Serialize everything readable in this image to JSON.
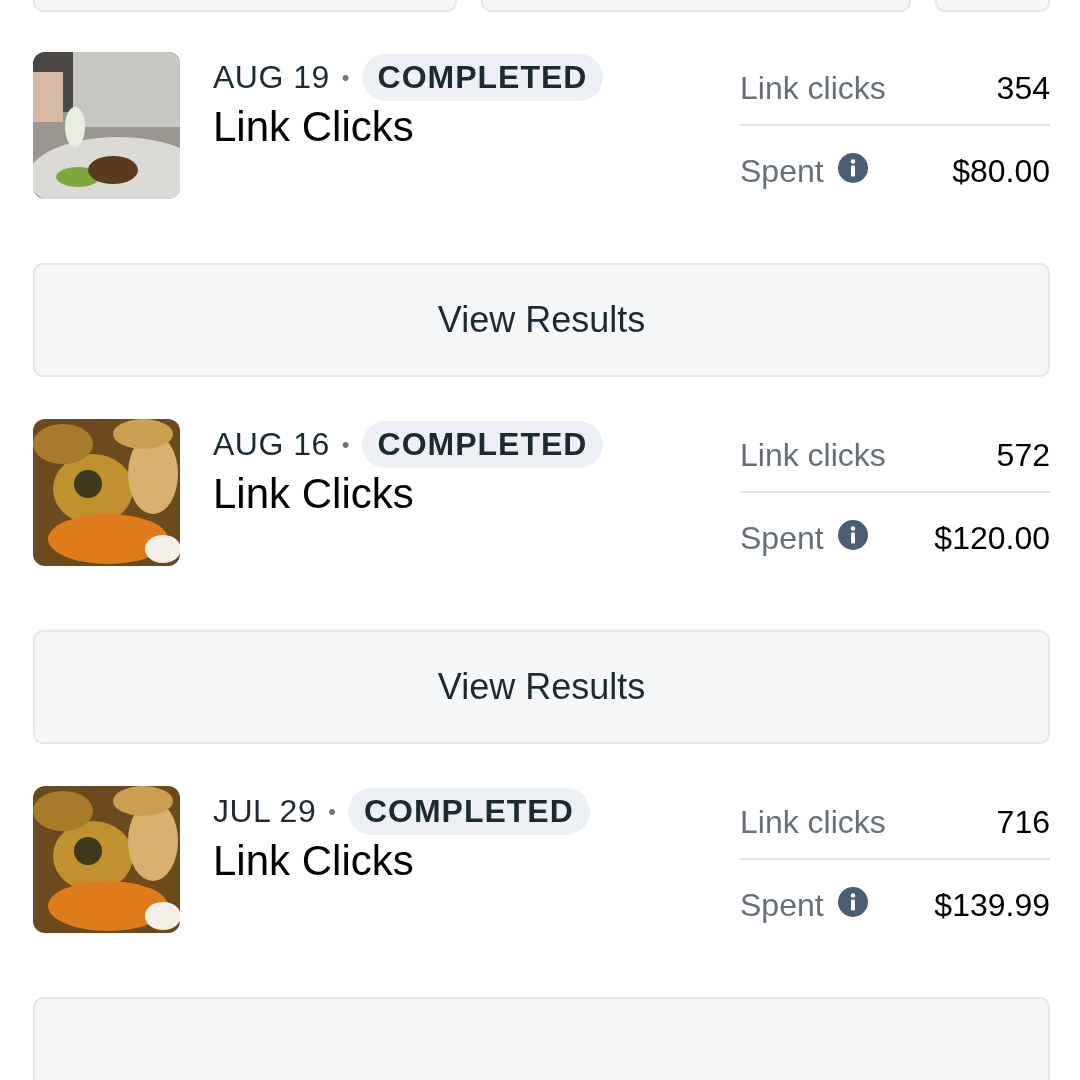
{
  "campaigns": [
    {
      "date": "AUG 19",
      "separator": "•",
      "status": "COMPLETED",
      "title": "Link Clicks",
      "metric_label": "Link clicks",
      "metric_value": "354",
      "spent_label": "Spent",
      "spent_value": "$80.00",
      "button": "View Results"
    },
    {
      "date": "AUG 16",
      "separator": "•",
      "status": "COMPLETED",
      "title": "Link Clicks",
      "metric_label": "Link clicks",
      "metric_value": "572",
      "spent_label": "Spent",
      "spent_value": "$120.00",
      "button": "View Results"
    },
    {
      "date": "JUL 29",
      "separator": "•",
      "status": "COMPLETED",
      "title": "Link Clicks",
      "metric_label": "Link clicks",
      "metric_value": "716",
      "spent_label": "Spent",
      "spent_value": "$139.99"
    }
  ]
}
